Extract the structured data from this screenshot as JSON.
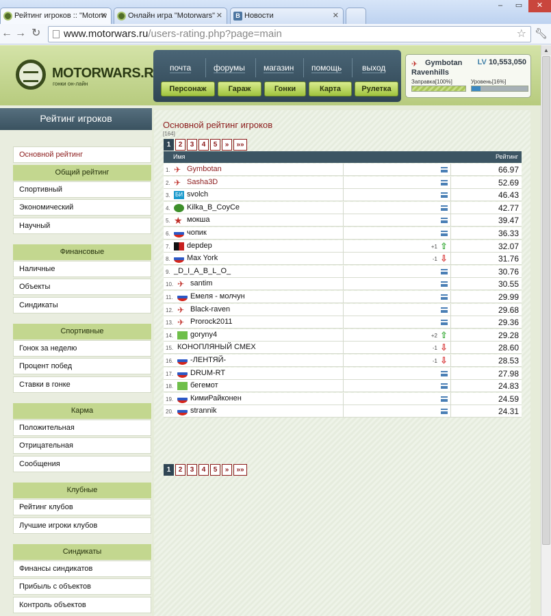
{
  "browser": {
    "tabs": [
      {
        "label": "Рейтинг игроков :: \"Motorw",
        "icon": "motorwars-favicon",
        "active": true
      },
      {
        "label": "Онлайн игра \"Motorwars\"",
        "icon": "motorwars-favicon",
        "active": false
      },
      {
        "label": "Новости",
        "icon": "vk-favicon",
        "active": false
      }
    ],
    "url_host": "www.motorwars.ru",
    "url_path": "/users-rating.php?page=main"
  },
  "site": {
    "logo_text": "MOTORWARS.RU",
    "logo_sub": "гонки он-лайн",
    "top_menu": [
      "почта",
      "форумы",
      "магазин",
      "помощь",
      "выход"
    ],
    "green_buttons": [
      "Персонаж",
      "Гараж",
      "Гонки",
      "Карта",
      "Рулетка"
    ],
    "user": {
      "name_line1": "Gymbotan",
      "name_line2": "Ravenhills",
      "lv_label": "LV",
      "money": "10,553,050",
      "fuel_label": "Заправка",
      "fuel_pct": "[100%]",
      "fuel_value": 1.0,
      "level_label": "Уровень",
      "level_pct": "[16%]",
      "level_value": 0.16
    }
  },
  "sidebar": {
    "title": "Рейтинг игроков",
    "main_item": "Основной рейтинг",
    "groups": [
      {
        "title": "Общий рейтинг",
        "items": [
          "Спортивный",
          "Экономический",
          "Научный"
        ]
      },
      {
        "title": "Финансовые",
        "items": [
          "Наличные",
          "Объекты",
          "Синдикаты"
        ]
      },
      {
        "title": "Спортивные",
        "items": [
          "Гонок за неделю",
          "Процент побед",
          "Ставки в гонке"
        ]
      },
      {
        "title": "Карма",
        "items": [
          "Положительная",
          "Отрицательная",
          "Сообщения"
        ]
      },
      {
        "title": "Клубные",
        "items": [
          "Рейтинг клубов",
          "Лучшие игроки клубов"
        ]
      },
      {
        "title": "Синдикаты",
        "items": [
          "Финансы синдикатов",
          "Прибыль с объектов",
          "Контроль объектов"
        ]
      }
    ]
  },
  "main": {
    "title": "Основной рейтинг игроков",
    "count": "[164]",
    "pager": [
      "1",
      "2",
      "3",
      "4",
      "5",
      "»",
      "»»"
    ],
    "col_name": "Имя",
    "col_rating": "Рейтинг",
    "rows": [
      {
        "num": "1.",
        "name": "Gymbotan",
        "flag": "plane",
        "red": true,
        "delta": "",
        "trend": "none",
        "score": "66.97"
      },
      {
        "num": "2.",
        "name": "Sasha3D",
        "flag": "plane",
        "red": true,
        "delta": "",
        "trend": "none",
        "score": "52.69"
      },
      {
        "num": "3.",
        "name": "svolch",
        "flag": "ue",
        "red": false,
        "delta": "",
        "trend": "none",
        "score": "46.43"
      },
      {
        "num": "4.",
        "name": "Kilka_B_CoyCe",
        "flag": "sun",
        "red": false,
        "delta": "",
        "trend": "none",
        "score": "42.77"
      },
      {
        "num": "5.",
        "name": "мокша",
        "flag": "star",
        "red": false,
        "delta": "",
        "trend": "none",
        "score": "39.47"
      },
      {
        "num": "6.",
        "name": "чопик",
        "flag": "ru",
        "red": false,
        "delta": "",
        "trend": "none",
        "score": "36.33"
      },
      {
        "num": "7.",
        "name": "depdep",
        "flag": "dd",
        "red": false,
        "delta": "+1",
        "trend": "up",
        "score": "32.07"
      },
      {
        "num": "8.",
        "name": "Max York",
        "flag": "ru",
        "red": false,
        "delta": "-1",
        "trend": "down",
        "score": "31.76"
      },
      {
        "num": "9.",
        "name": "_D_I_A_B_L_O_",
        "flag": "none",
        "red": false,
        "delta": "",
        "trend": "none",
        "score": "30.76"
      },
      {
        "num": "10.",
        "name": "santim",
        "flag": "plane",
        "red": false,
        "delta": "",
        "trend": "none",
        "score": "30.55"
      },
      {
        "num": "11.",
        "name": "Емеля - молчун",
        "flag": "ru",
        "red": false,
        "delta": "",
        "trend": "none",
        "score": "29.99"
      },
      {
        "num": "12.",
        "name": "Black-raven",
        "flag": "plane",
        "red": false,
        "delta": "",
        "trend": "none",
        "score": "29.68"
      },
      {
        "num": "13.",
        "name": "Prorock2011",
        "flag": "plane",
        "red": false,
        "delta": "",
        "trend": "none",
        "score": "29.36"
      },
      {
        "num": "14.",
        "name": "goryny4",
        "flag": "green",
        "red": false,
        "delta": "+2",
        "trend": "up",
        "score": "29.28"
      },
      {
        "num": "15.",
        "name": "КОНОПЛЯНЫЙ СМЕХ",
        "flag": "none",
        "red": false,
        "delta": "-1",
        "trend": "down",
        "score": "28.60"
      },
      {
        "num": "16.",
        "name": "-ЛЕНТЯЙ-",
        "flag": "ru",
        "red": false,
        "delta": "-1",
        "trend": "down",
        "score": "28.53"
      },
      {
        "num": "17.",
        "name": "DRUM-RT",
        "flag": "ru",
        "red": false,
        "delta": "",
        "trend": "none",
        "score": "27.98"
      },
      {
        "num": "18.",
        "name": "бегемот",
        "flag": "green",
        "red": false,
        "delta": "",
        "trend": "none",
        "score": "24.83"
      },
      {
        "num": "19.",
        "name": "КимиРайконен",
        "flag": "ru",
        "red": false,
        "delta": "",
        "trend": "none",
        "score": "24.59"
      },
      {
        "num": "20.",
        "name": "strannik",
        "flag": "ru",
        "red": false,
        "delta": "",
        "trend": "none",
        "score": "24.31"
      }
    ]
  }
}
